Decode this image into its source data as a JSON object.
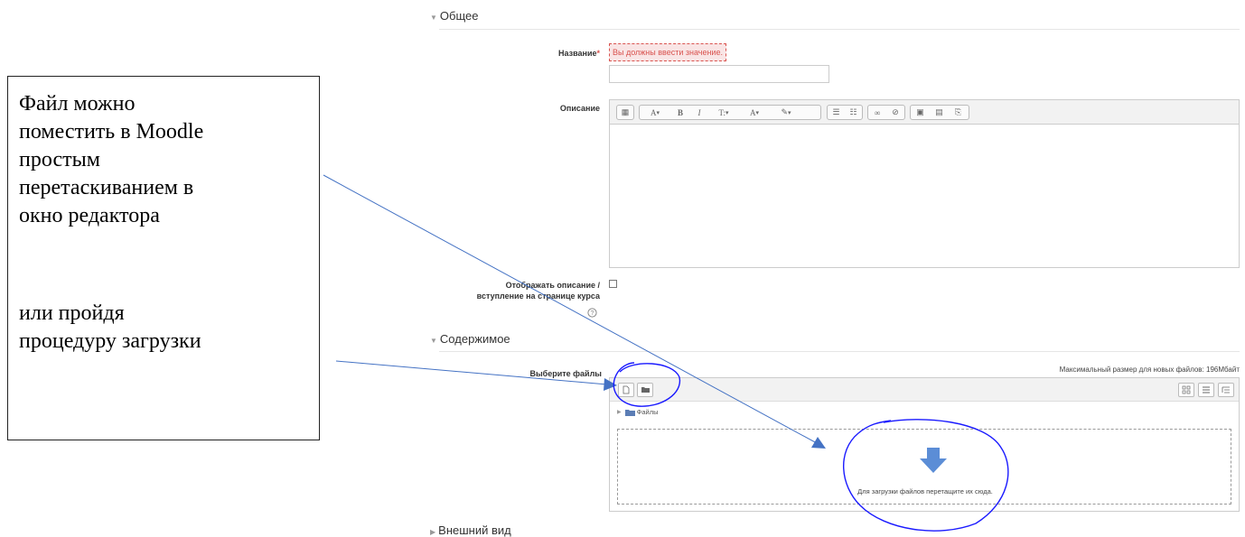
{
  "sections": {
    "general": "Общее",
    "content": "Содержимое",
    "appearance": "Внешний вид"
  },
  "form": {
    "name_label": "Название",
    "required_mark": "*",
    "name_error": "Вы должны ввести значение.",
    "name_value": "",
    "description_label": "Описание",
    "show_description_label_line1": "Отображать описание /",
    "show_description_label_line2": "вступление на странице курса",
    "show_description_checked": false,
    "help_icon": "question-circle-icon",
    "select_files_label": "Выберите файлы",
    "max_size_text": "Максимальный размер для новых файлов: 196Мбайт",
    "files_folder_label": "Файлы",
    "dropzone_text": "Для загрузки файлов перетащите их сюда."
  },
  "editor_toolbar": [
    {
      "group": 1,
      "buttons": [
        "show-more-icon"
      ]
    },
    {
      "group": 2,
      "buttons": [
        "paragraph-styles-icon",
        "bold-icon",
        "italic-icon",
        "font-size-icon",
        "font-color-icon",
        "background-color-icon"
      ]
    },
    {
      "group": 3,
      "buttons": [
        "unordered-list-icon",
        "ordered-list-icon"
      ]
    },
    {
      "group": 4,
      "buttons": [
        "link-icon",
        "unlink-icon"
      ]
    },
    {
      "group": 5,
      "buttons": [
        "image-icon",
        "media-icon",
        "manage-files-icon"
      ]
    }
  ],
  "editor_labels": {
    "bold": "B",
    "italic": "I",
    "font_size": "T:",
    "styles": "A",
    "color": "A"
  },
  "annotation": {
    "line1": "Файл можно",
    "line2": "поместить в Moodle",
    "line3": "простым",
    "line4": "перетаскиванием в",
    "line5": "окно редактора",
    "line6": "или пройдя",
    "line7": "процедуру загрузки"
  },
  "colors": {
    "error": "#d9534f",
    "error_bg": "#f9e5e5",
    "annotation_arrow": "#4472c4",
    "annotation_circle": "#1a1aff",
    "drop_arrow": "#5b8dd6"
  }
}
